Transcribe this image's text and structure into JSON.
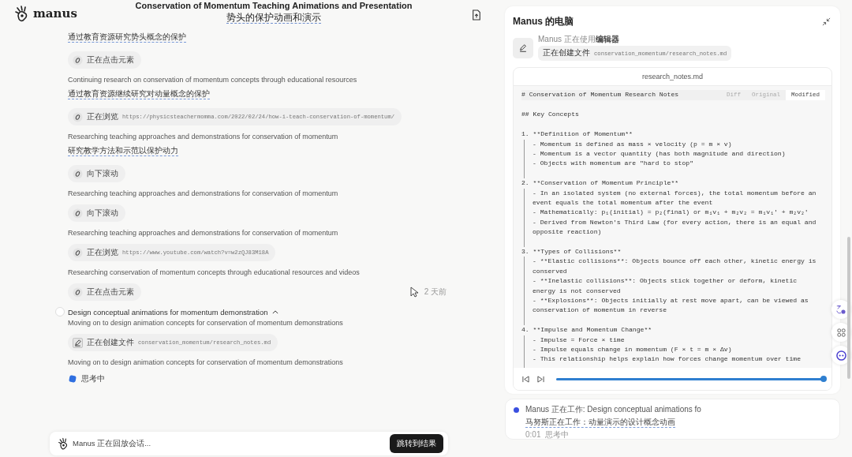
{
  "header": {
    "brand": "manus",
    "title": "Conservation of Momentum Teaching Animations and Presentation",
    "subtitle": "势头的保护动画和演示"
  },
  "steps": [
    {
      "kind": "translation",
      "text": "通过教育资源研究势头概念的保护"
    },
    {
      "kind": "browser",
      "action": "正在点击元素"
    },
    {
      "kind": "text",
      "text": "Continuing research on conservation of momentum concepts through educational resources"
    },
    {
      "kind": "translation",
      "text": "通过教育资源继续研究对动量概念的保护"
    },
    {
      "kind": "browser",
      "action": "正在浏览",
      "detail": "https://physicsteachermomma.com/2022/02/24/how-i-teach-conservation-of-momentum/"
    },
    {
      "kind": "text",
      "text": "Researching teaching approaches and demonstrations for conservation of momentum"
    },
    {
      "kind": "translation",
      "text": "研究教学方法和示范以保护动力"
    },
    {
      "kind": "browser",
      "action": "向下滚动"
    },
    {
      "kind": "text",
      "text": "Researching teaching approaches and demonstrations for conservation of momentum"
    },
    {
      "kind": "browser",
      "action": "向下滚动"
    },
    {
      "kind": "text",
      "text": "Researching teaching approaches and demonstrations for conservation of momentum"
    },
    {
      "kind": "browser",
      "action": "正在浏览",
      "detail": "https://www.youtube.com/watch?v=w2zQJ83M18A"
    },
    {
      "kind": "text",
      "text": "Researching conservation of momentum concepts through educational resources and videos"
    },
    {
      "kind": "browser",
      "action": "正在点击元素",
      "time": "2 天前"
    },
    {
      "kind": "step",
      "text": "Design conceptual animations for momentum demonstration",
      "expanded": true
    },
    {
      "kind": "text",
      "text": "Moving on to design animation concepts for conservation of momentum demonstrations"
    },
    {
      "kind": "editor",
      "action": "正在创建文件",
      "detail": "conservation_momentum/research_notes.md"
    },
    {
      "kind": "text",
      "text": "Moving on to design animation concepts for conservation of momentum demonstrations"
    },
    {
      "kind": "thinking",
      "text": "思考中"
    }
  ],
  "replay_bar": {
    "text": "Manus 正在回放会话...",
    "button": "跳转到结果"
  },
  "computer": {
    "title": "Manus 的电脑",
    "status": "Manus 正在使用**编辑器**",
    "action": "正在创建文件",
    "detail": "conservation_momentum/research_notes.md",
    "file": "research_notes.md",
    "tabs": [
      {
        "label": "Diff",
        "selected": false
      },
      {
        "label": "Original",
        "selected": false
      },
      {
        "label": "Modified",
        "selected": true
      }
    ],
    "code_title": "# Conservation of Momentum Research Notes",
    "code_heading": "## Key Concepts",
    "sections": [
      {
        "title": "1. **Definition of Momentum**",
        "items": [
          "- Momentum is defined as mass × velocity (p = m × v)",
          "- Momentum is a vector quantity (has both magnitude and direction)",
          "- Objects with momentum are \"hard to stop\""
        ]
      },
      {
        "title": "2. **Conservation of Momentum Principle**",
        "items": [
          "- In an isolated system (no external forces), the total momentum before an event equals the total momentum after the event",
          "- Mathematically: p₁(initial) = p₂(final) or m₁v₁ + m₂v₂ = m₁v₁' + m₂v₂'",
          "- Derived from Newton's Third Law (for every action, there is an equal and opposite reaction)"
        ]
      },
      {
        "title": "3. **Types of Collisions**",
        "items": [
          "- **Elastic collisions**: Objects bounce off each other, kinetic energy is conserved",
          "- **Inelastic collisions**: Objects stick together or deform, kinetic energy is not conserved",
          "- **Explosions**: Objects initially at rest move apart, can be viewed as conservation of momentum in reverse"
        ]
      },
      {
        "title": "4. **Impulse and Momentum Change**",
        "items": [
          "- Impulse = Force × time",
          "- Impulse equals change in momentum (F × t = m × Δv)",
          "- This relationship helps explain how forces change momentum over time"
        ]
      }
    ],
    "player": {
      "level": 1
    }
  },
  "status_card": {
    "text": "Manus 正在工作: Design conceptual animations fo",
    "translation": "马努斯正在工作：动量演示的设计概念动画",
    "time": "0:01",
    "state": "思考中"
  }
}
